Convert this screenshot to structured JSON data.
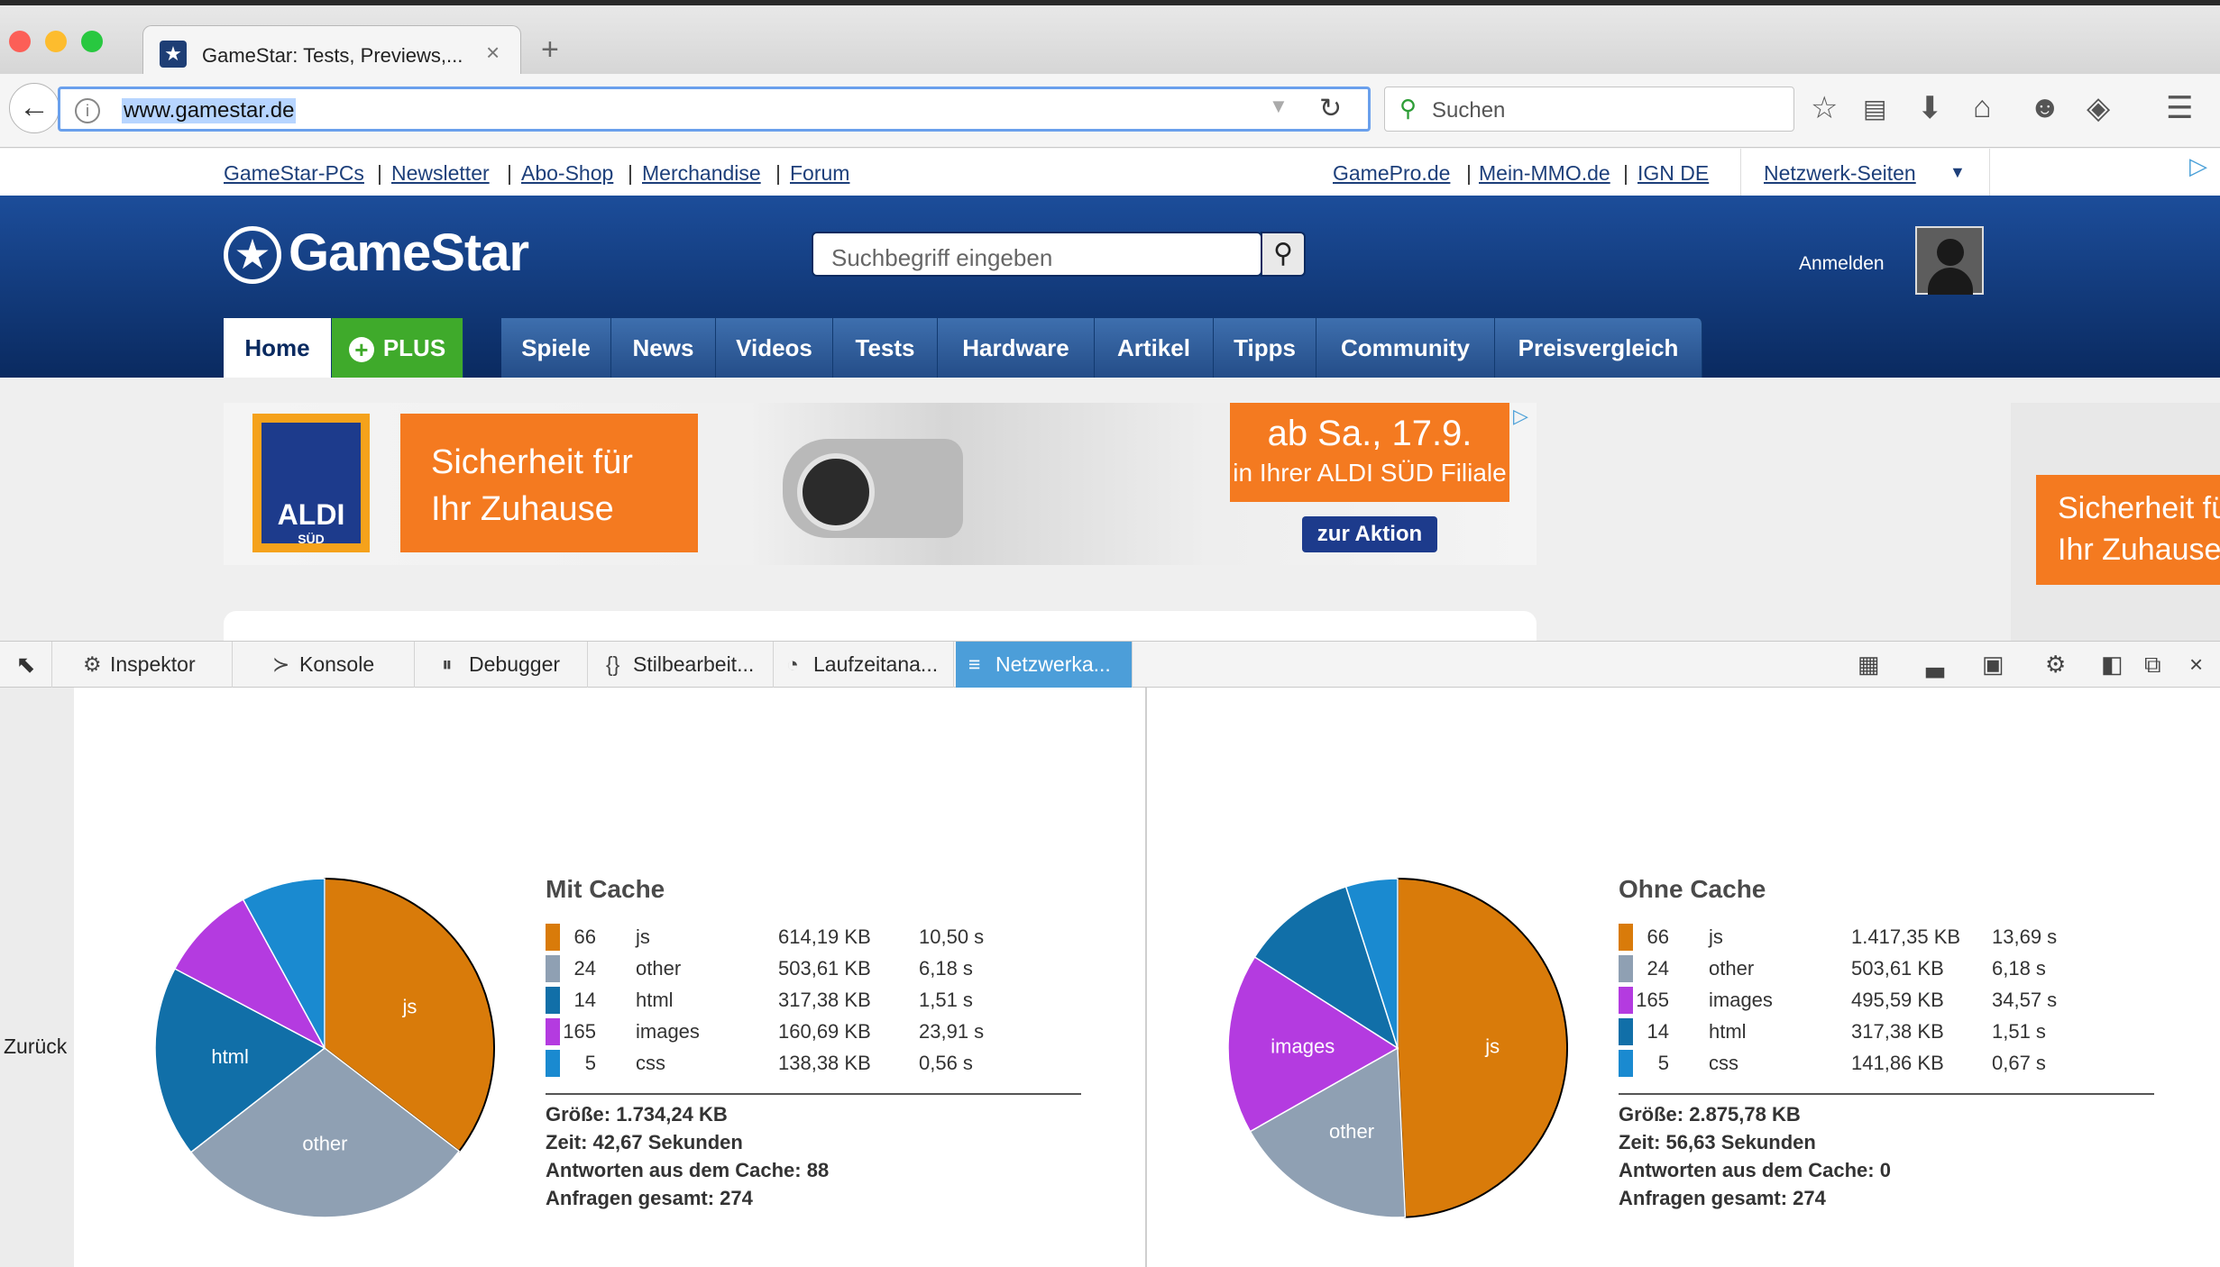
{
  "browser": {
    "tab_title": "GameStar: Tests, Previews,...",
    "url": "www.gamestar.de",
    "search_placeholder": "Suchen"
  },
  "toplinks": {
    "left": [
      "GameStar-PCs",
      "Newsletter",
      "Abo-Shop",
      "Merchandise",
      "Forum"
    ],
    "right": [
      "GamePro.de",
      "Mein-MMO.de",
      "IGN DE"
    ],
    "network": "Netzwerk-Seiten"
  },
  "site": {
    "logo": "GameStar",
    "search_placeholder": "Suchbegriff eingeben",
    "login": "Anmelden",
    "nav": [
      "Home",
      "PLUS",
      "Spiele",
      "News",
      "Videos",
      "Tests",
      "Hardware",
      "Artikel",
      "Tipps",
      "Community",
      "Preisvergleich"
    ]
  },
  "ad": {
    "brand": "ALDI",
    "brand_sub": "SÜD",
    "headline_1": "Sicherheit für",
    "headline_2": "Ihr Zuhause",
    "date_line_1": "ab Sa., 17.9.",
    "date_line_2": "in Ihrer ALDI SÜD Filiale",
    "cta": "zur Aktion",
    "side_headline_1": "Sicherheit fü",
    "side_headline_2": "Ihr Zuhause"
  },
  "devtools": {
    "tabs": [
      "Inspektor",
      "Konsole",
      "Debugger",
      "Stilbearbeit...",
      "Laufzeitana...",
      "Netzwerka..."
    ],
    "back": "Zurück"
  },
  "colors": {
    "js": "#d97b0a",
    "other": "#8fa0b3",
    "html": "#116fa8",
    "images": "#b43be0",
    "css": "#1a8ad0"
  },
  "chart_data": [
    {
      "type": "pie",
      "title": "Mit Cache",
      "rows": [
        {
          "count": "66",
          "type": "js",
          "size": "614,19 KB",
          "time": "10,50 s"
        },
        {
          "count": "24",
          "type": "other",
          "size": "503,61 KB",
          "time": "6,18 s"
        },
        {
          "count": "14",
          "type": "html",
          "size": "317,38 KB",
          "time": "1,51 s"
        },
        {
          "count": "165",
          "type": "images",
          "size": "160,69 KB",
          "time": "23,91 s"
        },
        {
          "count": "5",
          "type": "css",
          "size": "138,38 KB",
          "time": "0,56 s"
        }
      ],
      "slices": [
        {
          "label": "js",
          "value": 614.19
        },
        {
          "label": "other",
          "value": 503.61
        },
        {
          "label": "html",
          "value": 317.38
        },
        {
          "label": "images",
          "value": 160.69
        },
        {
          "label": "css",
          "value": 138.38
        }
      ],
      "summary": {
        "size": "Größe: 1.734,24 KB",
        "time": "Zeit: 42,67 Sekunden",
        "cached": "Antworten aus dem Cache: 88",
        "total": "Anfragen gesamt: 274"
      }
    },
    {
      "type": "pie",
      "title": "Ohne Cache",
      "rows": [
        {
          "count": "66",
          "type": "js",
          "size": "1.417,35 KB",
          "time": "13,69 s"
        },
        {
          "count": "24",
          "type": "other",
          "size": "503,61 KB",
          "time": "6,18 s"
        },
        {
          "count": "165",
          "type": "images",
          "size": "495,59 KB",
          "time": "34,57 s"
        },
        {
          "count": "14",
          "type": "html",
          "size": "317,38 KB",
          "time": "1,51 s"
        },
        {
          "count": "5",
          "type": "css",
          "size": "141,86 KB",
          "time": "0,67 s"
        }
      ],
      "slices": [
        {
          "label": "js",
          "value": 1417.35
        },
        {
          "label": "other",
          "value": 503.61
        },
        {
          "label": "images",
          "value": 495.59
        },
        {
          "label": "html",
          "value": 317.38
        },
        {
          "label": "css",
          "value": 141.86
        }
      ],
      "summary": {
        "size": "Größe: 2.875,78 KB",
        "time": "Zeit: 56,63 Sekunden",
        "cached": "Antworten aus dem Cache: 0",
        "total": "Anfragen gesamt: 274"
      }
    }
  ]
}
